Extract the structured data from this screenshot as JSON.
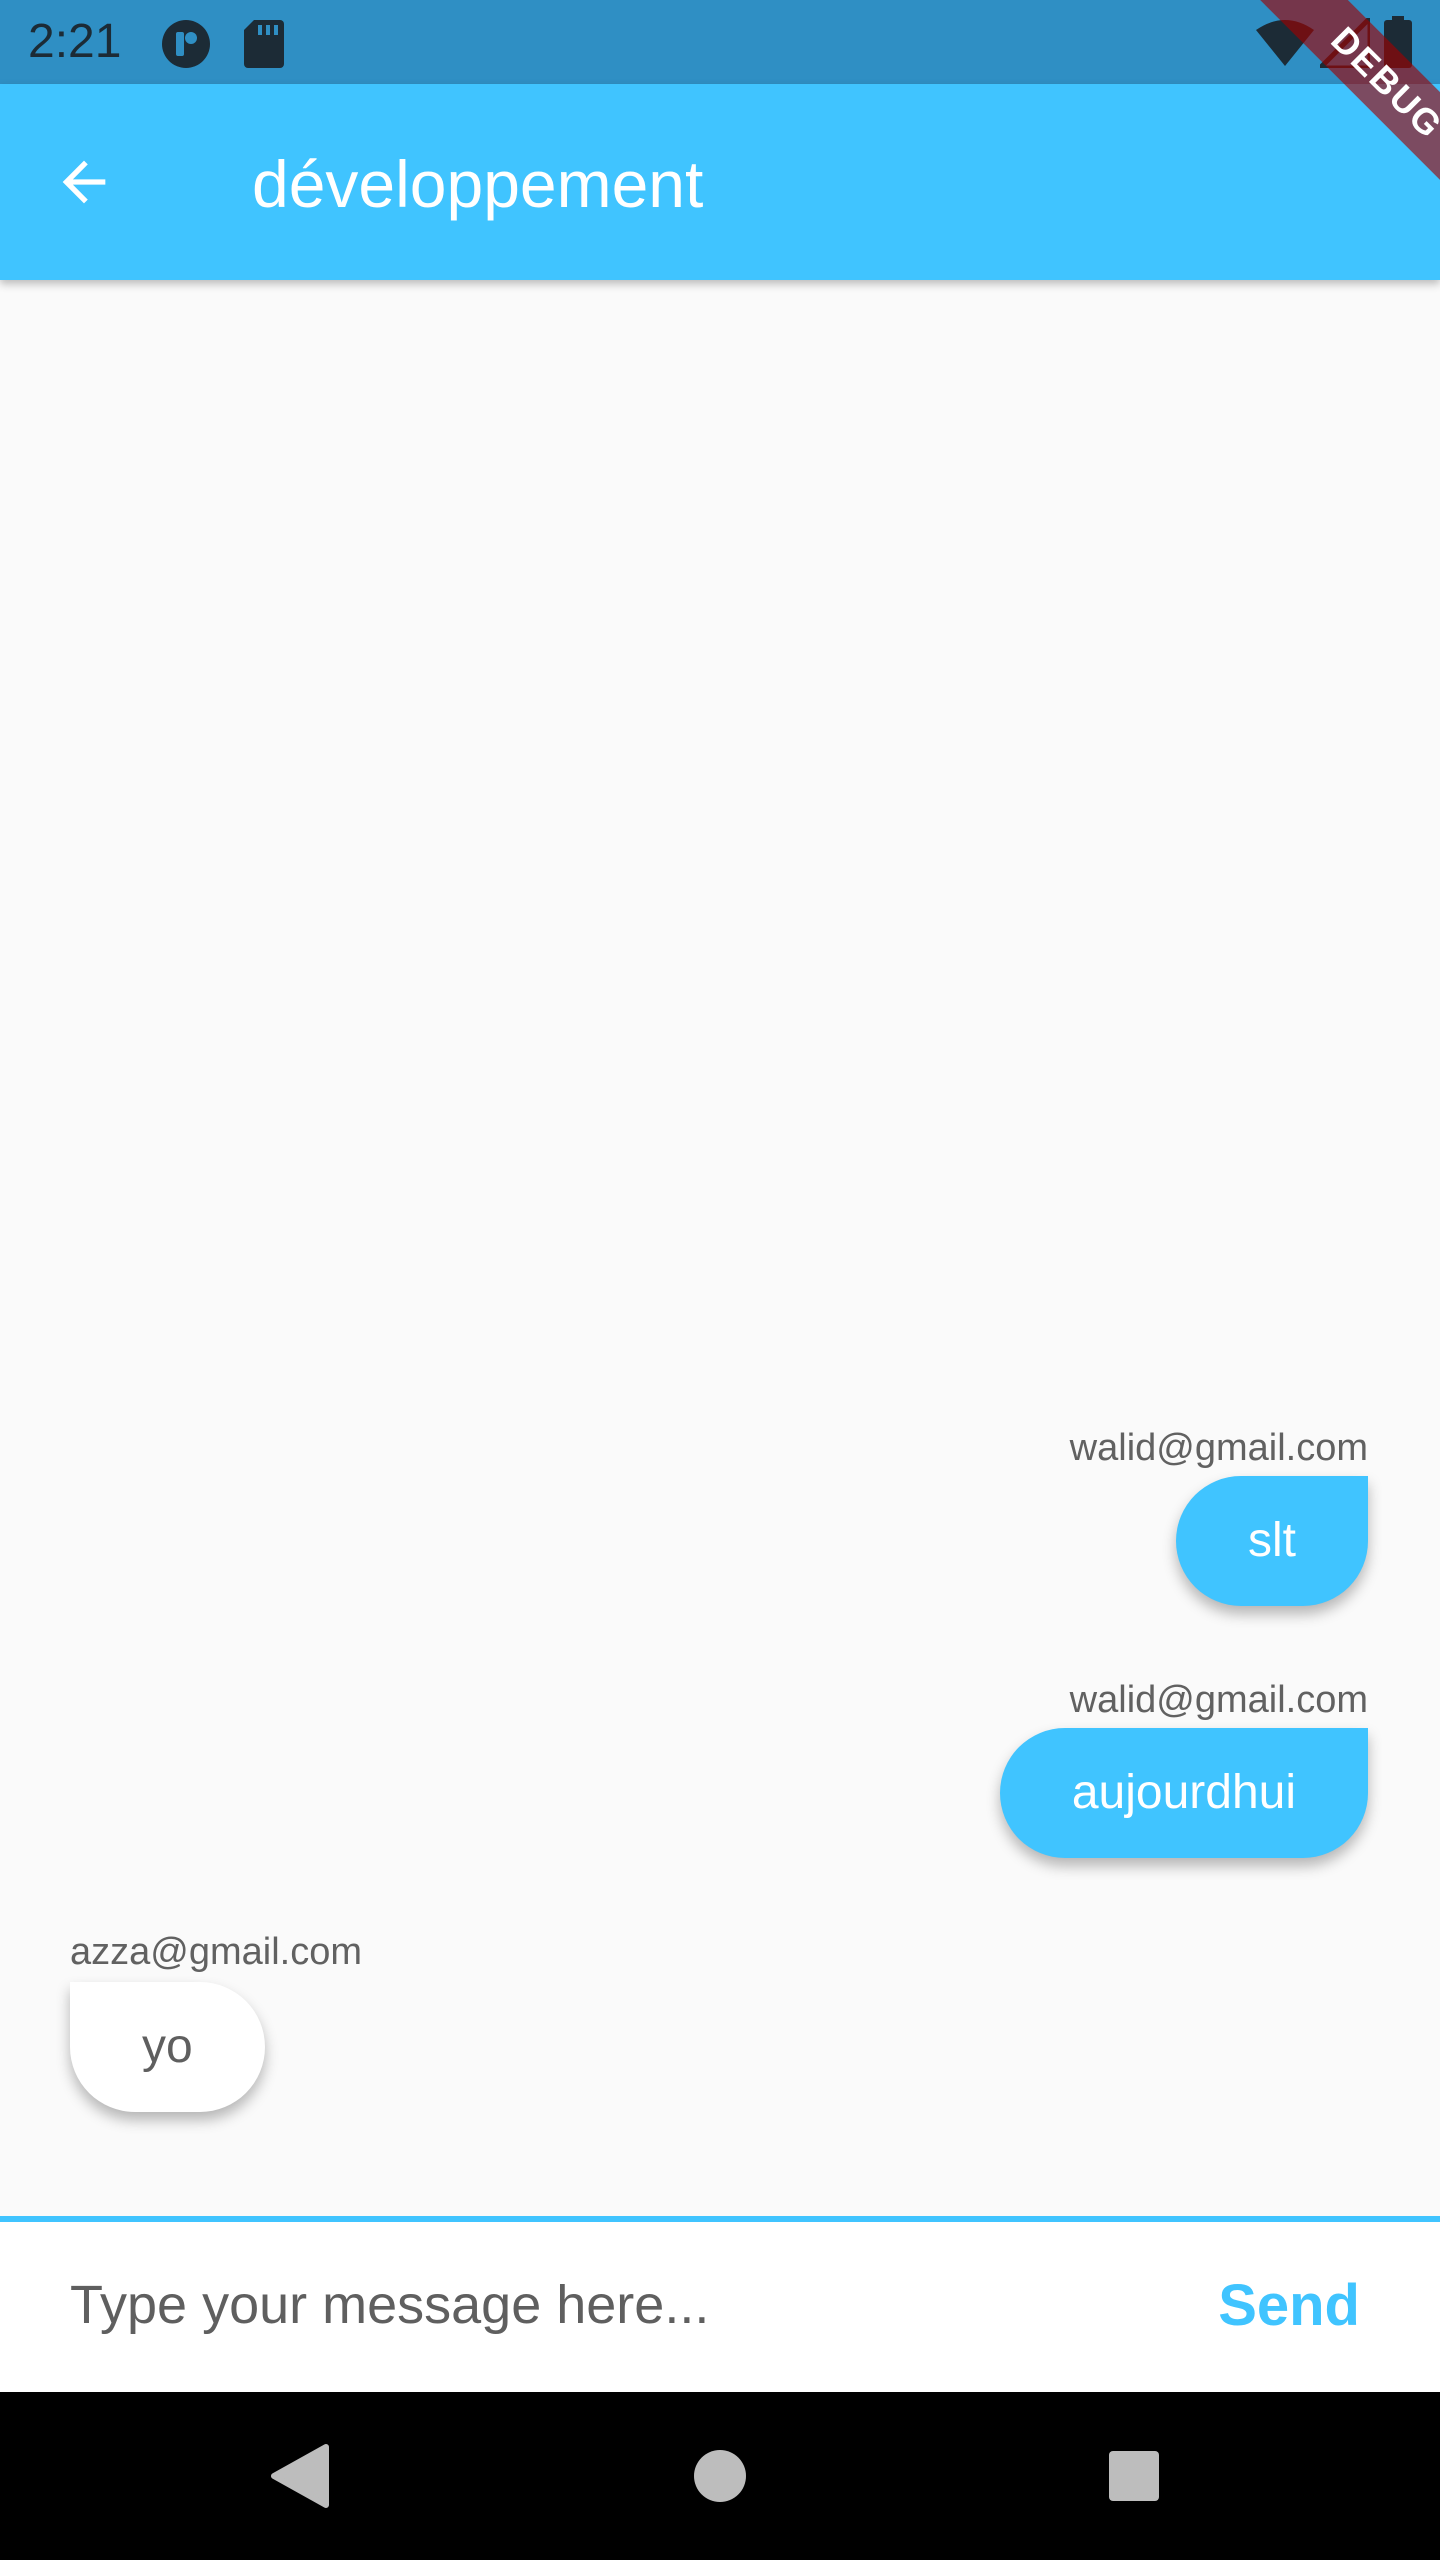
{
  "status_bar": {
    "time": "2:21",
    "left_icons": [
      "app-notification-icon",
      "sd-card-icon"
    ],
    "right_icons": [
      "wifi-icon",
      "cell-signal-icon",
      "battery-icon"
    ]
  },
  "debug_banner": {
    "label": "DEBUG"
  },
  "app_bar": {
    "back_icon": "arrow-back-icon",
    "title": "développement",
    "background": "#40c4ff"
  },
  "messages": [
    {
      "sender": "walid@gmail.com",
      "text": "slt",
      "own": true
    },
    {
      "sender": "walid@gmail.com",
      "text": "aujourdhui",
      "own": true
    },
    {
      "sender": "azza@gmail.com",
      "text": "yo",
      "own": false
    }
  ],
  "composer": {
    "placeholder": "Type your message here...",
    "value": "",
    "send_label": "Send"
  },
  "nav_bar": {
    "buttons": [
      "back-triangle-icon",
      "home-circle-icon",
      "recents-square-icon"
    ]
  },
  "colors": {
    "accent": "#40c4ff",
    "status_bar": "#2f8fc4",
    "background": "#fafafa",
    "debug_banner": "#a20000"
  }
}
